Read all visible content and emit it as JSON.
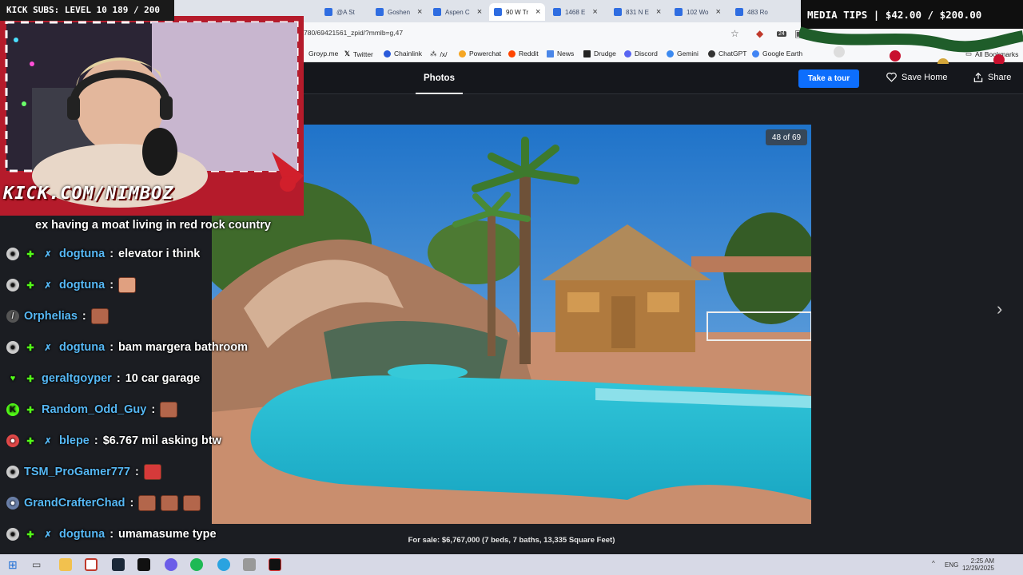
{
  "browser": {
    "tabs": [
      {
        "label": "@A St",
        "active": false
      },
      {
        "label": "Goshen",
        "active": false
      },
      {
        "label": "Aspen C",
        "active": false
      },
      {
        "label": "90 W Tr",
        "active": true
      },
      {
        "label": "1468 E",
        "active": false
      },
      {
        "label": "831 N E",
        "active": false
      },
      {
        "label": "102 Wo",
        "active": false
      },
      {
        "label": "483 Ro",
        "active": false
      }
    ],
    "url": "780/69421561_zpid/?mmlb=g,47",
    "bookmarks": [
      "Groyp.me",
      "Twitter",
      "Chainlink",
      "/x/",
      "Powerchat",
      "Reddit",
      "News",
      "Drudge",
      "Discord",
      "Gemini",
      "ChatGPT",
      "Google Earth"
    ],
    "bookmarks_all": "All Bookmarks",
    "extension_badge": "24"
  },
  "site": {
    "photos_tab": "Photos",
    "tour_button": "Take a tour",
    "save_home": "Save Home",
    "share": "Share",
    "photo_counter": "48 of 69",
    "caption": "For sale: $6,767,000 (7 beds, 7 baths, 13,335 Square Feet)"
  },
  "overlay": {
    "subs_banner": "KICK SUBS: LEVEL 10 189 / 200",
    "kick_url": "KICK.COM/NIMBOZ",
    "media_tips": "MEDIA TIPS | $42.00 / $200.00"
  },
  "chat": {
    "partial_line": "ex having a moat living in red rock country",
    "messages": [
      {
        "user": "dogtuna",
        "text": "elevator i think",
        "emotes": 0
      },
      {
        "user": "dogtuna",
        "text": "",
        "emotes": 1
      },
      {
        "user": "Orphelias",
        "text": "",
        "emotes": 1
      },
      {
        "user": "dogtuna",
        "text": "bam margera bathroom",
        "emotes": 0
      },
      {
        "user": "geraltgoyper",
        "text": "10 car garage",
        "emotes": 0
      },
      {
        "user": "Random_Odd_Guy",
        "text": "",
        "emotes": 1
      },
      {
        "user": "blepe",
        "text": "$6.767 mil asking btw",
        "emotes": 0
      },
      {
        "user": "TSM_ProGamer777",
        "text": "",
        "emotes": 1
      },
      {
        "user": "GrandCrafterChad",
        "text": "",
        "emotes": 3
      },
      {
        "user": "dogtuna",
        "text": "umamasume type",
        "emotes": 0
      }
    ]
  },
  "taskbar": {
    "lang": "ENG",
    "time": "2:25 AM",
    "date": "12/29/2025"
  }
}
